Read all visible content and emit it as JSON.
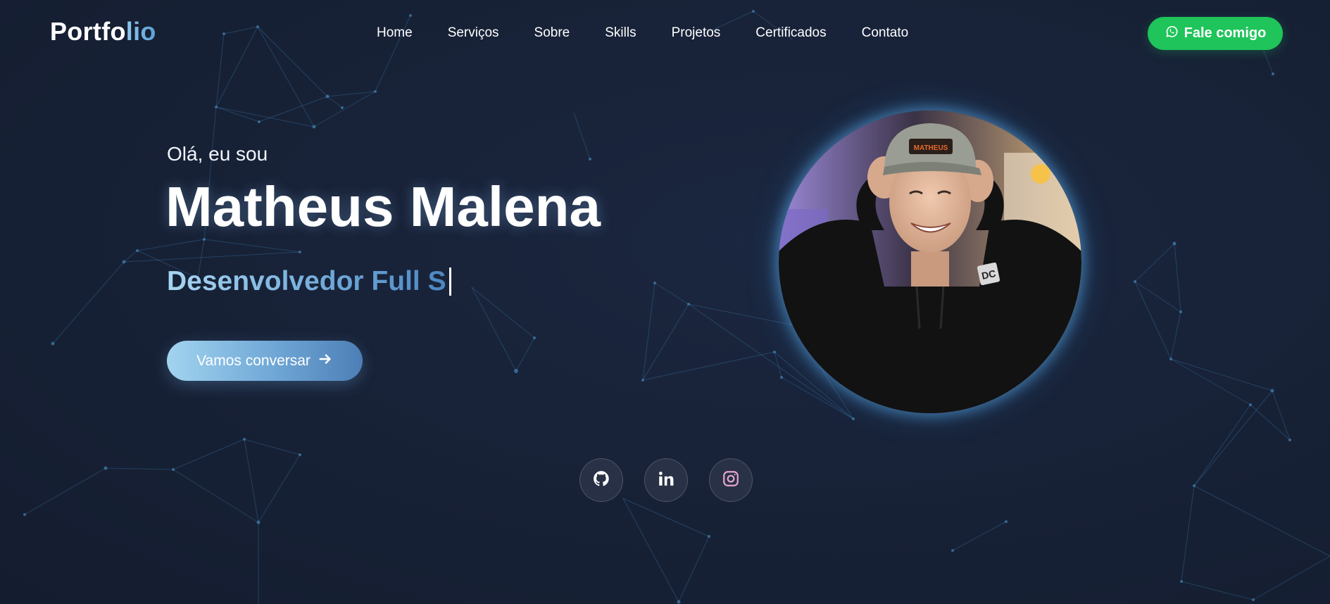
{
  "header": {
    "logo_main": "Portfo",
    "logo_accent": "lio",
    "nav": [
      "Home",
      "Serviços",
      "Sobre",
      "Skills",
      "Projetos",
      "Certificados",
      "Contato"
    ],
    "cta_label": "Fale comigo",
    "cta_icon": "whatsapp-icon",
    "cta_color": "#1fc45a"
  },
  "hero": {
    "greeting": "Olá, eu sou",
    "name": "Matheus Malena",
    "role_typed": "Desenvolvedor Full S",
    "button_label": "Vamos conversar",
    "button_icon": "arrow-right-icon"
  },
  "photo": {
    "cap_text": "MATHEUS",
    "shirt_logo": "DC"
  },
  "socials": [
    {
      "name": "github",
      "icon": "github-icon"
    },
    {
      "name": "linkedin",
      "icon": "linkedin-icon"
    },
    {
      "name": "instagram",
      "icon": "instagram-icon"
    }
  ],
  "colors": {
    "background": "#172136",
    "accent": "#6ea8d8",
    "whatsapp": "#1fc45a"
  }
}
